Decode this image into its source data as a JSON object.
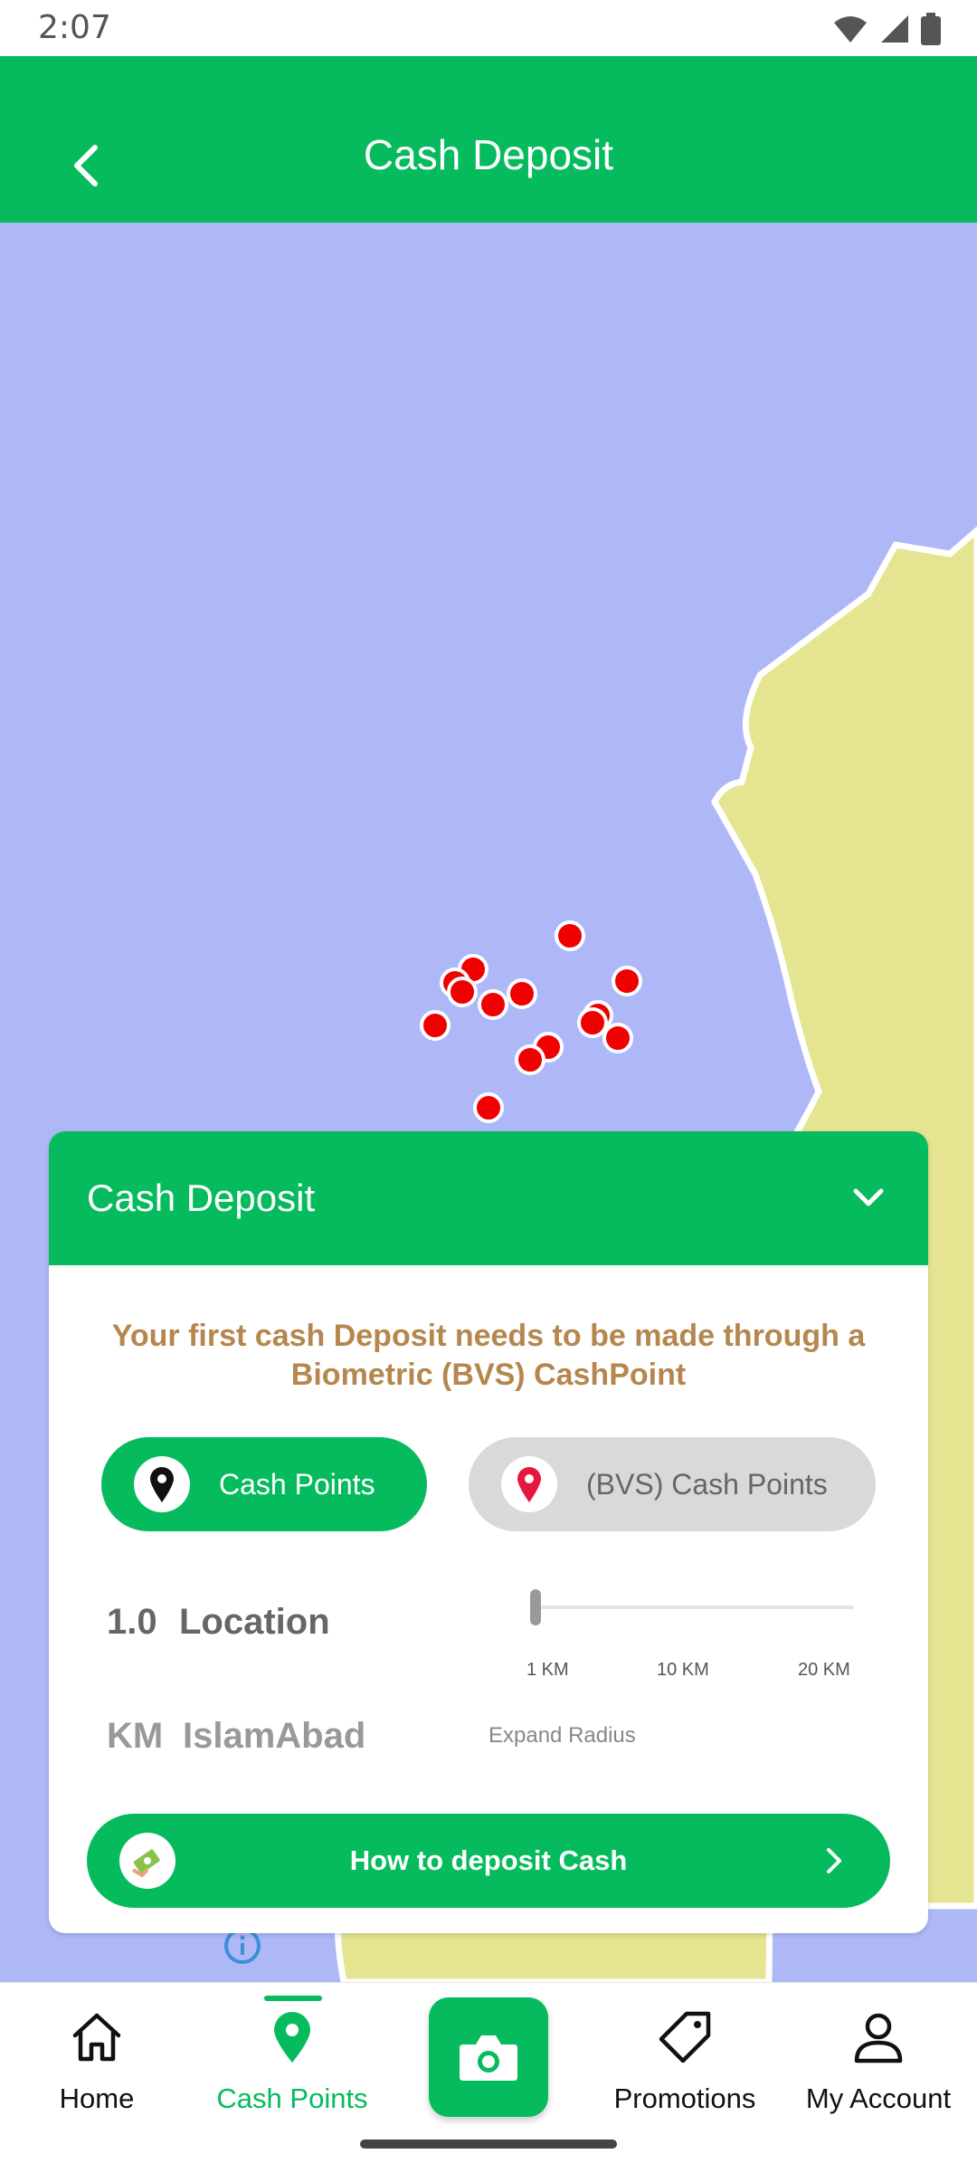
{
  "status_bar": {
    "time": "2:07"
  },
  "header": {
    "title": "Cash Deposit"
  },
  "panel": {
    "title": "Cash Deposit",
    "notice": "Your first cash Deposit needs to be made through a Biometric (BVS) CashPoint",
    "filters": {
      "cash_points_label": "Cash Points",
      "bvs_label": "(BVS) Cash Points"
    },
    "radius": {
      "value": "1.0",
      "label": "Location",
      "unit": "KM",
      "city": "IslamAbad",
      "ticks": [
        "1 KM",
        "10 KM",
        "20 KM"
      ],
      "expand_label": "Expand Radius",
      "slider_value_km": 1.0
    },
    "cta_label": "How to deposit Cash"
  },
  "nav": {
    "home": "Home",
    "cash_points": "Cash Points",
    "promotions": "Promotions",
    "account": "My Account"
  },
  "colors": {
    "brand_green": "#06BB5E",
    "water": "#AEB8F7",
    "land": "#E5E491",
    "marker_red": "#F00000",
    "notice_text": "#B5874E"
  }
}
